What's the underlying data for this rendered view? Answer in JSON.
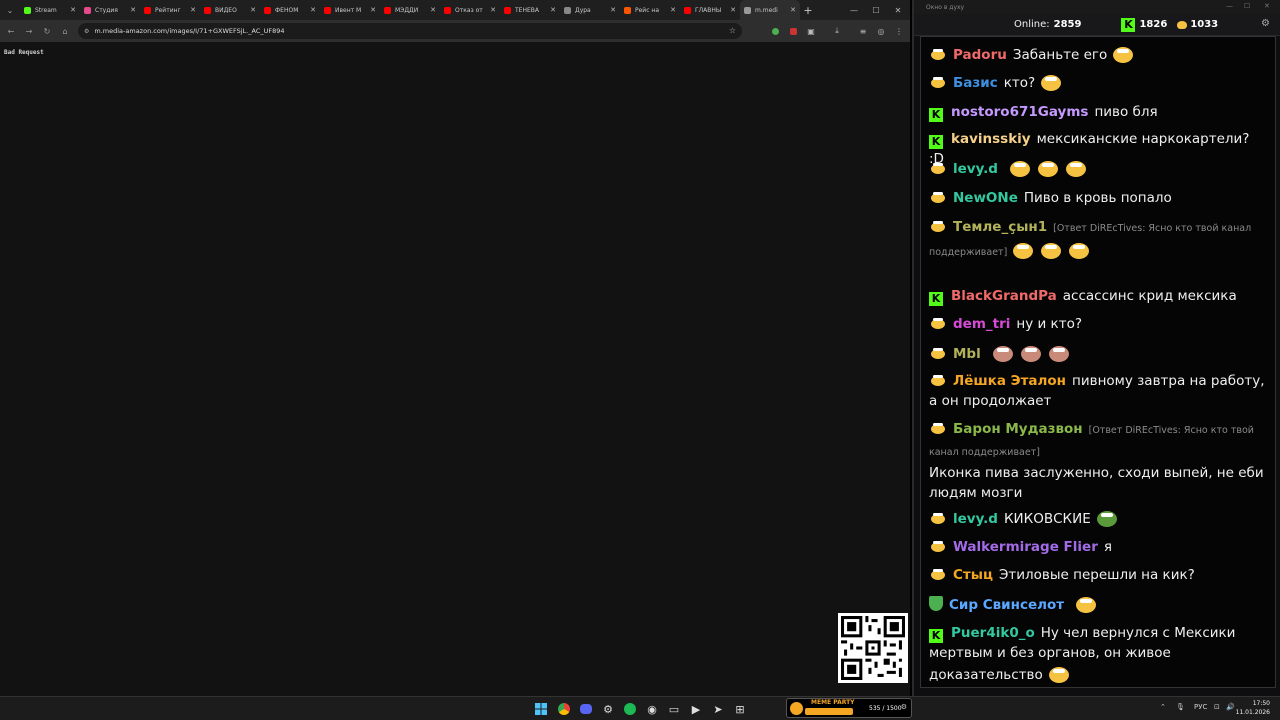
{
  "browser": {
    "tabs": [
      {
        "title": "Stream",
        "color": "#53fc18"
      },
      {
        "title": "Студия",
        "color": "#e64a8a"
      },
      {
        "title": "Рейтинг",
        "color": "#ff0000"
      },
      {
        "title": "ВИДЕО",
        "color": "#ff0000"
      },
      {
        "title": "ФЕНОМ",
        "color": "#ff0000"
      },
      {
        "title": "Ивент М",
        "color": "#ff0000"
      },
      {
        "title": "МЭДДИ",
        "color": "#ff0000"
      },
      {
        "title": "Отказ от",
        "color": "#ff0000"
      },
      {
        "title": "ТЕНЕВА",
        "color": "#ff0000"
      },
      {
        "title": "Дура",
        "color": "#888888"
      },
      {
        "title": "Рейс на",
        "color": "#ff5500"
      },
      {
        "title": "ГЛАВНЫ",
        "color": "#ff0000"
      },
      {
        "title": "m.medi",
        "color": "#999999"
      }
    ],
    "url": "m.media-amazon.com/images/I/71+GXWEFSjL._AC_UF894",
    "page_message": "Bad Request"
  },
  "chat": {
    "window_title": "Окно в духу",
    "online_label": "Online:",
    "online_count": "2859",
    "kick_count": "1826",
    "beer_count": "1033",
    "messages": [
      {
        "user": "Padoru",
        "color": "#f06a6a",
        "text": "Забаньте его",
        "badge": "beer"
      },
      {
        "user": "Базис",
        "color": "#3d8fe0",
        "text": "кто?",
        "badge": "beer"
      },
      {
        "user": "nostoro671Gayms",
        "color": "#c59aff",
        "text": "пиво бля",
        "badge": "k"
      },
      {
        "user": "kavinsskiy",
        "color": "#f5d08a",
        "text": "мексиканские наркокартели? :D",
        "badge": "k"
      },
      {
        "user": "levy.d",
        "color": "#33c8a0",
        "text": "",
        "badge": "beer"
      },
      {
        "user": "NewONe",
        "color": "#33c8a0",
        "text": "Пиво в кровь попало",
        "badge": "beer"
      },
      {
        "user": "Темле_çын1",
        "color": "#b2b25a",
        "reply": "[Ответ DiREcTives: Ясно кто твой канал поддерживает]",
        "badge": "beer"
      },
      {
        "user": "BlackGrandPa",
        "color": "#f06a6a",
        "text": "ассассинс крид мексика",
        "badge": "k"
      },
      {
        "user": "dem_tri",
        "color": "#d64bd6",
        "text": "ну и кто?",
        "badge": "beer"
      },
      {
        "user": "Mbl",
        "color": "#b2b25a",
        "text": "",
        "badge": "beer"
      },
      {
        "user": "Лёшка Эталон",
        "color": "#f5a623",
        "text": "пивному завтра на работу, а он продолжает",
        "badge": "beer"
      },
      {
        "user": "Барон Мудазвон",
        "color": "#8ab84a",
        "reply": "[Ответ DiREcTives: Ясно кто твой канал поддерживает]",
        "text": "Иконка пива заслуженно, сходи выпей, не еби людям мозги",
        "badge": "beer"
      },
      {
        "user": "levy.d",
        "color": "#33c8a0",
        "text": "КИКОВСКИЕ",
        "badge": "beer"
      },
      {
        "user": "Walkermirage Flier",
        "color": "#a46be8",
        "text": "я",
        "badge": "beer"
      },
      {
        "user": "Стыц",
        "color": "#f5a623",
        "text": "Этиловые перешли на кик?",
        "badge": "beer"
      },
      {
        "user": "Сир Свинселот",
        "color": "#5aa8ff",
        "text": "",
        "badge": "shield"
      },
      {
        "user": "Puer4ik0_o",
        "color": "#33c8a0",
        "text": "Ну чел вернулся с Мексики мертвым и без органов, он живое доказательство",
        "badge": "k"
      }
    ]
  },
  "taskbar": {
    "meme_title": "MEME PARTY",
    "meme_progress": "535 / 1500",
    "lang": "РУС",
    "time": "17:50",
    "date": "11.01.2026"
  }
}
